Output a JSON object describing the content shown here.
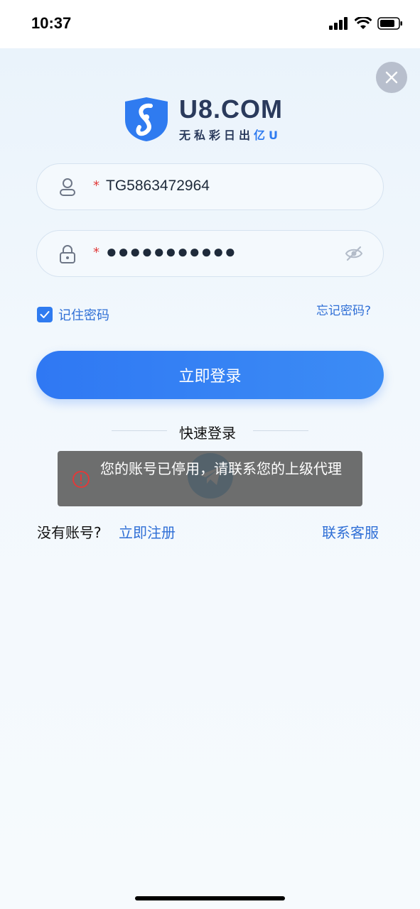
{
  "status_bar": {
    "time": "10:37",
    "icons": [
      "signal-icon",
      "wifi-icon",
      "battery-icon"
    ]
  },
  "logo": {
    "brand": "U8.COM",
    "tagline_main": "无私彩日出",
    "tagline_accent": "亿U"
  },
  "form": {
    "username": {
      "required_mark": "*",
      "value": "TG5863472964",
      "icon": "user-icon"
    },
    "password": {
      "required_mark": "*",
      "value": "●●●●●●●●●●●",
      "icon": "lock-icon",
      "toggle_icon": "eye-off-icon"
    },
    "remember_label": "记住密码",
    "remember_checked": true,
    "forgot_label": "忘记密码?",
    "login_label": "立即登录"
  },
  "quick_login": {
    "label": "快速登录",
    "icon": "telegram-icon"
  },
  "toast": {
    "message": "您的账号已停用，请联系您的上级代理",
    "icon": "alert-circle-icon"
  },
  "footer": {
    "no_account": "没有账号?",
    "register": "立即注册",
    "customer_service": "联系客服"
  },
  "colors": {
    "accent": "#2f7bf0",
    "link": "#2f6fd6",
    "required": "#e03a3a",
    "toast_bg": "#5a5a5a"
  }
}
